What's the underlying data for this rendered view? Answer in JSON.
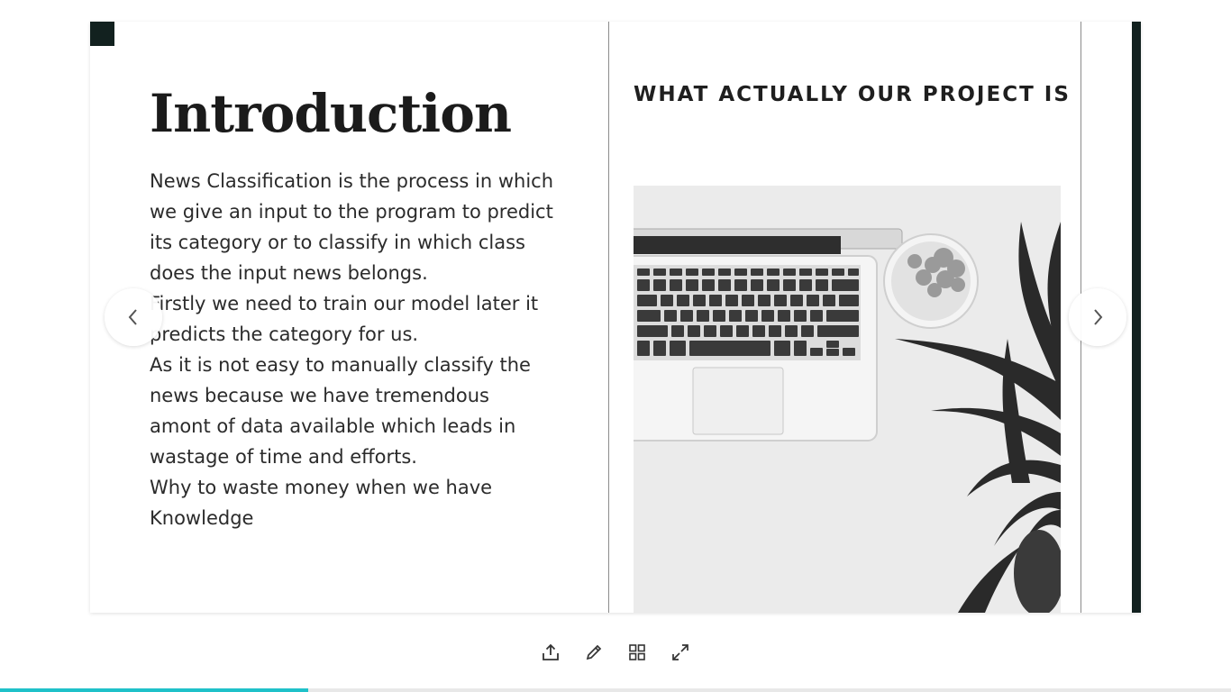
{
  "slide": {
    "title": "Introduction",
    "paragraphs": [
      "News Classification is the process in which we give an input to the program to predict its category or to classify in which class does the input news belongs.",
      "Firstly we need to train our model later it predicts the category for us.",
      "As it is not easy to manually classify the news because we have tremendous amont of data available which leads in wastage of time and efforts.",
      "Why to waste money when we have Knowledge"
    ],
    "right_heading": "WHAT ACTUALLY OUR PROJECT IS",
    "image_icon": "laptop-plant-photo"
  },
  "navigation": {
    "prev_icon": "chevron-left-icon",
    "next_icon": "chevron-right-icon"
  },
  "toolbar": {
    "icons": [
      "share-icon",
      "edit-pencil-icon",
      "grid-view-icon",
      "fullscreen-icon"
    ]
  },
  "progress": {
    "fraction": 0.25
  },
  "colors": {
    "accent": "#1fc1c9",
    "dark_block": "#12211f"
  }
}
